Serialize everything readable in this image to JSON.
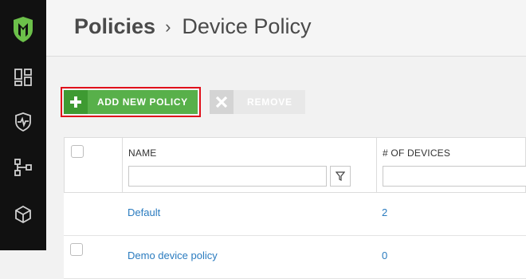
{
  "sidebar": {
    "items": [
      {
        "icon": "shield-logo-icon"
      },
      {
        "icon": "dashboard-icon"
      },
      {
        "icon": "shield-pulse-icon"
      },
      {
        "icon": "network-tree-icon"
      },
      {
        "icon": "cube-icon"
      }
    ]
  },
  "header": {
    "breadcrumb_root": "Policies",
    "breadcrumb_separator": "›",
    "breadcrumb_current": "Device Policy"
  },
  "toolbar": {
    "add_label": "ADD NEW POLICY",
    "remove_label": "REMOVE"
  },
  "table": {
    "columns": [
      "NAME",
      "# OF DEVICES"
    ],
    "rows": [
      {
        "name": "Default",
        "devices": "2"
      },
      {
        "name": "Demo device policy",
        "devices": "0"
      }
    ]
  },
  "colors": {
    "sidebar_bg": "#111111",
    "accent_green": "#58b04a",
    "highlight_red": "#e0101b",
    "link_blue": "#2a7bbf"
  }
}
